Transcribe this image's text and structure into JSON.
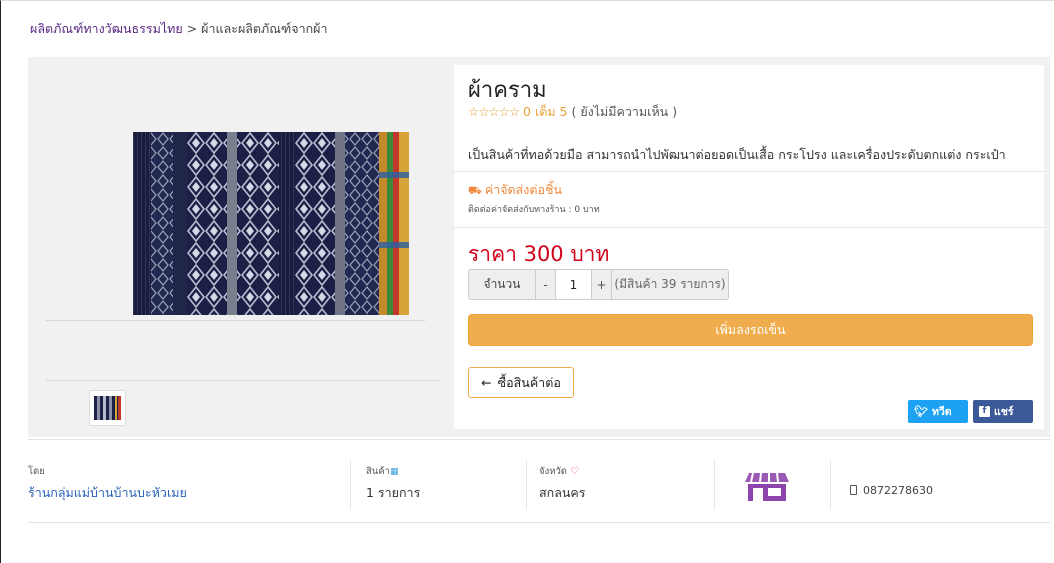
{
  "breadcrumb": {
    "parent": "ผลิตภัณฑ์ทางวัฒนธรรมไทย",
    "separator": ">",
    "current": "ผ้าและผลิตภัณฑ์จากผ้า"
  },
  "product": {
    "title": "ผ้าคราม",
    "rating_stars": "☆☆☆☆☆",
    "rating_score": "0 เต็ม 5",
    "rating_note": "( ยังไม่มีความเห็น )",
    "description": "เป็นสินค้าที่ทอด้วยมือ สามารถนำไปพัฒนาต่อยอดเป็นเสื้อ กระโปรง และเครื่องประดับตกแต่ง กระเป๋า",
    "shipping_title": "ค่าจัดส่งต่อชิ้น",
    "shipping_note": "ติดต่อค่าจัดส่งกับทางร้าน : 0 บาท",
    "price": "ราคา 300 บาท"
  },
  "quantity": {
    "label": "จำนวน",
    "minus": "-",
    "value": "1",
    "plus": "+",
    "stock_note": "(มีสินค้า 39 รายการ)"
  },
  "actions": {
    "add_to_cart": "เพิ่มลงรถเข็น",
    "continue_arrow": "←",
    "continue_shopping": "ซื้อสินค้าต่อ",
    "tweet": "ทวีต",
    "share": "แชร์"
  },
  "shop": {
    "by_label": "โดย",
    "shop_name": "ร้านกลุ่มแม่บ้านบ้านบะหัวเมย",
    "products_label": "สินค้า",
    "products_count": "1 รายการ",
    "province_label": "จังหวัด",
    "province": "สกลนคร",
    "phone": "0872278630"
  },
  "colors": {
    "accent_orange": "#f0ad4e",
    "price_red": "#d0021b",
    "link_purple": "#5a2a82",
    "link_blue": "#2a64b8",
    "twitter": "#1da1f2",
    "facebook": "#3b5998"
  },
  "icons": [
    "truck-icon",
    "twitter-icon",
    "facebook-icon",
    "cubes-icon",
    "map-pin-icon",
    "store-icon",
    "phone-icon"
  ]
}
